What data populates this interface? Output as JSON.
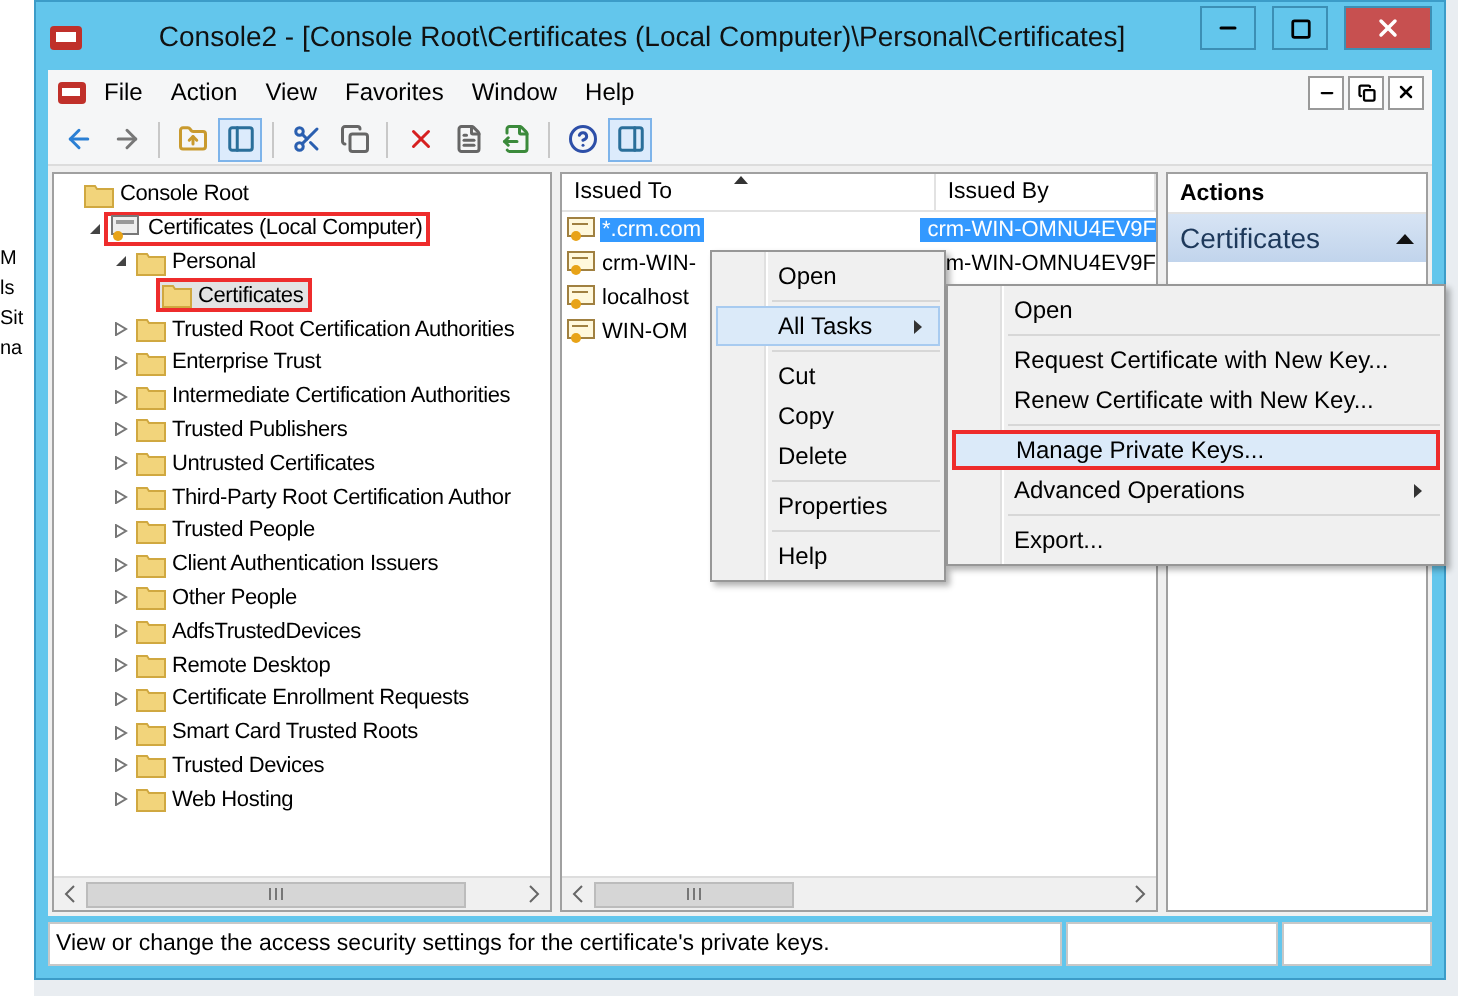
{
  "background_fragments": [
    "M",
    "ls",
    "Sit",
    "na"
  ],
  "window": {
    "title": "Console2 - [Console Root\\Certificates (Local Computer)\\Personal\\Certificates]"
  },
  "menu_bar": [
    "File",
    "Action",
    "View",
    "Favorites",
    "Window",
    "Help"
  ],
  "toolbar": [
    {
      "kind": "back",
      "pressed": false
    },
    {
      "kind": "forward",
      "pressed": false
    },
    {
      "kind": "separator"
    },
    {
      "kind": "up",
      "pressed": false
    },
    {
      "kind": "tree",
      "pressed": true
    },
    {
      "kind": "separator"
    },
    {
      "kind": "cut",
      "pressed": false
    },
    {
      "kind": "copy",
      "pressed": false
    },
    {
      "kind": "separator"
    },
    {
      "kind": "delete",
      "pressed": false
    },
    {
      "kind": "properties",
      "pressed": false
    },
    {
      "kind": "export",
      "pressed": false
    },
    {
      "kind": "separator"
    },
    {
      "kind": "help",
      "pressed": false
    },
    {
      "kind": "actionpane",
      "pressed": true
    }
  ],
  "tree": [
    {
      "label": "Console Root",
      "kind": "folder",
      "selected": false,
      "annotated": false,
      "children": [
        {
          "label": "Certificates (Local Computer)",
          "kind": "store",
          "expanded": true,
          "selected": false,
          "annotated": true,
          "children": [
            {
              "label": "Personal",
              "kind": "folder",
              "expanded": true,
              "selected": false,
              "annotated": false,
              "children": [
                {
                  "label": "Certificates",
                  "kind": "folder",
                  "selected": true,
                  "annotated": true
                }
              ]
            },
            {
              "label": "Trusted Root Certification Authorities",
              "kind": "folder",
              "expanded": false,
              "selected": false,
              "annotated": false
            },
            {
              "label": "Enterprise Trust",
              "kind": "folder",
              "expanded": false,
              "selected": false,
              "annotated": false
            },
            {
              "label": "Intermediate Certification Authorities",
              "kind": "folder",
              "expanded": false,
              "selected": false,
              "annotated": false
            },
            {
              "label": "Trusted Publishers",
              "kind": "folder",
              "expanded": false,
              "selected": false,
              "annotated": false
            },
            {
              "label": "Untrusted Certificates",
              "kind": "folder",
              "expanded": false,
              "selected": false,
              "annotated": false
            },
            {
              "label": "Third-Party Root Certification Author",
              "kind": "folder",
              "expanded": false,
              "selected": false,
              "annotated": false
            },
            {
              "label": "Trusted People",
              "kind": "folder",
              "expanded": false,
              "selected": false,
              "annotated": false
            },
            {
              "label": "Client Authentication Issuers",
              "kind": "folder",
              "expanded": false,
              "selected": false,
              "annotated": false
            },
            {
              "label": "Other People",
              "kind": "folder",
              "expanded": false,
              "selected": false,
              "annotated": false
            },
            {
              "label": "AdfsTrustedDevices",
              "kind": "folder",
              "expanded": false,
              "selected": false,
              "annotated": false
            },
            {
              "label": "Remote Desktop",
              "kind": "folder",
              "expanded": false,
              "selected": false,
              "annotated": false
            },
            {
              "label": "Certificate Enrollment Requests",
              "kind": "folder",
              "expanded": false,
              "selected": false,
              "annotated": false
            },
            {
              "label": "Smart Card Trusted Roots",
              "kind": "folder",
              "expanded": false,
              "selected": false,
              "annotated": false
            },
            {
              "label": "Trusted Devices",
              "kind": "folder",
              "expanded": false,
              "selected": false,
              "annotated": false
            },
            {
              "label": "Web Hosting",
              "kind": "folder",
              "expanded": false,
              "selected": false,
              "annotated": false
            }
          ]
        }
      ]
    }
  ],
  "table": {
    "columns": [
      "Issued To",
      "Issued By"
    ],
    "rows": [
      {
        "issued_to": "*.crm.com",
        "issued_by": "crm-WIN-OMNU4EV9F",
        "selected": true
      },
      {
        "issued_to": "crm-WIN-",
        "issued_by": "m-WIN-OMNU4EV9F",
        "selected": false
      },
      {
        "issued_to": "localhost",
        "selected": false
      },
      {
        "issued_to": "WIN-OM",
        "selected": false
      }
    ]
  },
  "actions": {
    "title": "Actions",
    "section": "Certificates"
  },
  "context_menu": [
    {
      "label": "Open",
      "kind": "item",
      "hovered": false,
      "submenu": false
    },
    {
      "kind": "separator"
    },
    {
      "label": "All Tasks",
      "kind": "item",
      "hovered": true,
      "submenu": true
    },
    {
      "kind": "separator"
    },
    {
      "label": "Cut",
      "kind": "item",
      "hovered": false,
      "submenu": false
    },
    {
      "label": "Copy",
      "kind": "item",
      "hovered": false,
      "submenu": false
    },
    {
      "label": "Delete",
      "kind": "item",
      "hovered": false,
      "submenu": false
    },
    {
      "kind": "separator"
    },
    {
      "label": "Properties",
      "kind": "item",
      "hovered": false,
      "submenu": false
    },
    {
      "kind": "separator"
    },
    {
      "label": "Help",
      "kind": "item",
      "hovered": false,
      "submenu": false
    }
  ],
  "submenu": [
    {
      "label": "Open",
      "kind": "item",
      "hovered": false,
      "submenu": false,
      "annotated": false
    },
    {
      "kind": "separator"
    },
    {
      "label": "Request Certificate with New Key...",
      "kind": "item",
      "hovered": false,
      "submenu": false,
      "annotated": false
    },
    {
      "label": "Renew Certificate with New Key...",
      "kind": "item",
      "hovered": false,
      "submenu": false,
      "annotated": false
    },
    {
      "kind": "separator"
    },
    {
      "label": "Manage Private Keys...",
      "kind": "item",
      "hovered": true,
      "submenu": false,
      "annotated": true
    },
    {
      "label": "Advanced Operations",
      "kind": "item",
      "hovered": false,
      "submenu": true,
      "annotated": false
    },
    {
      "kind": "separator"
    },
    {
      "label": "Export...",
      "kind": "item",
      "hovered": false,
      "submenu": false,
      "annotated": false
    }
  ],
  "status_bar": {
    "text": "View or change the access security settings for the certificate's private keys."
  }
}
